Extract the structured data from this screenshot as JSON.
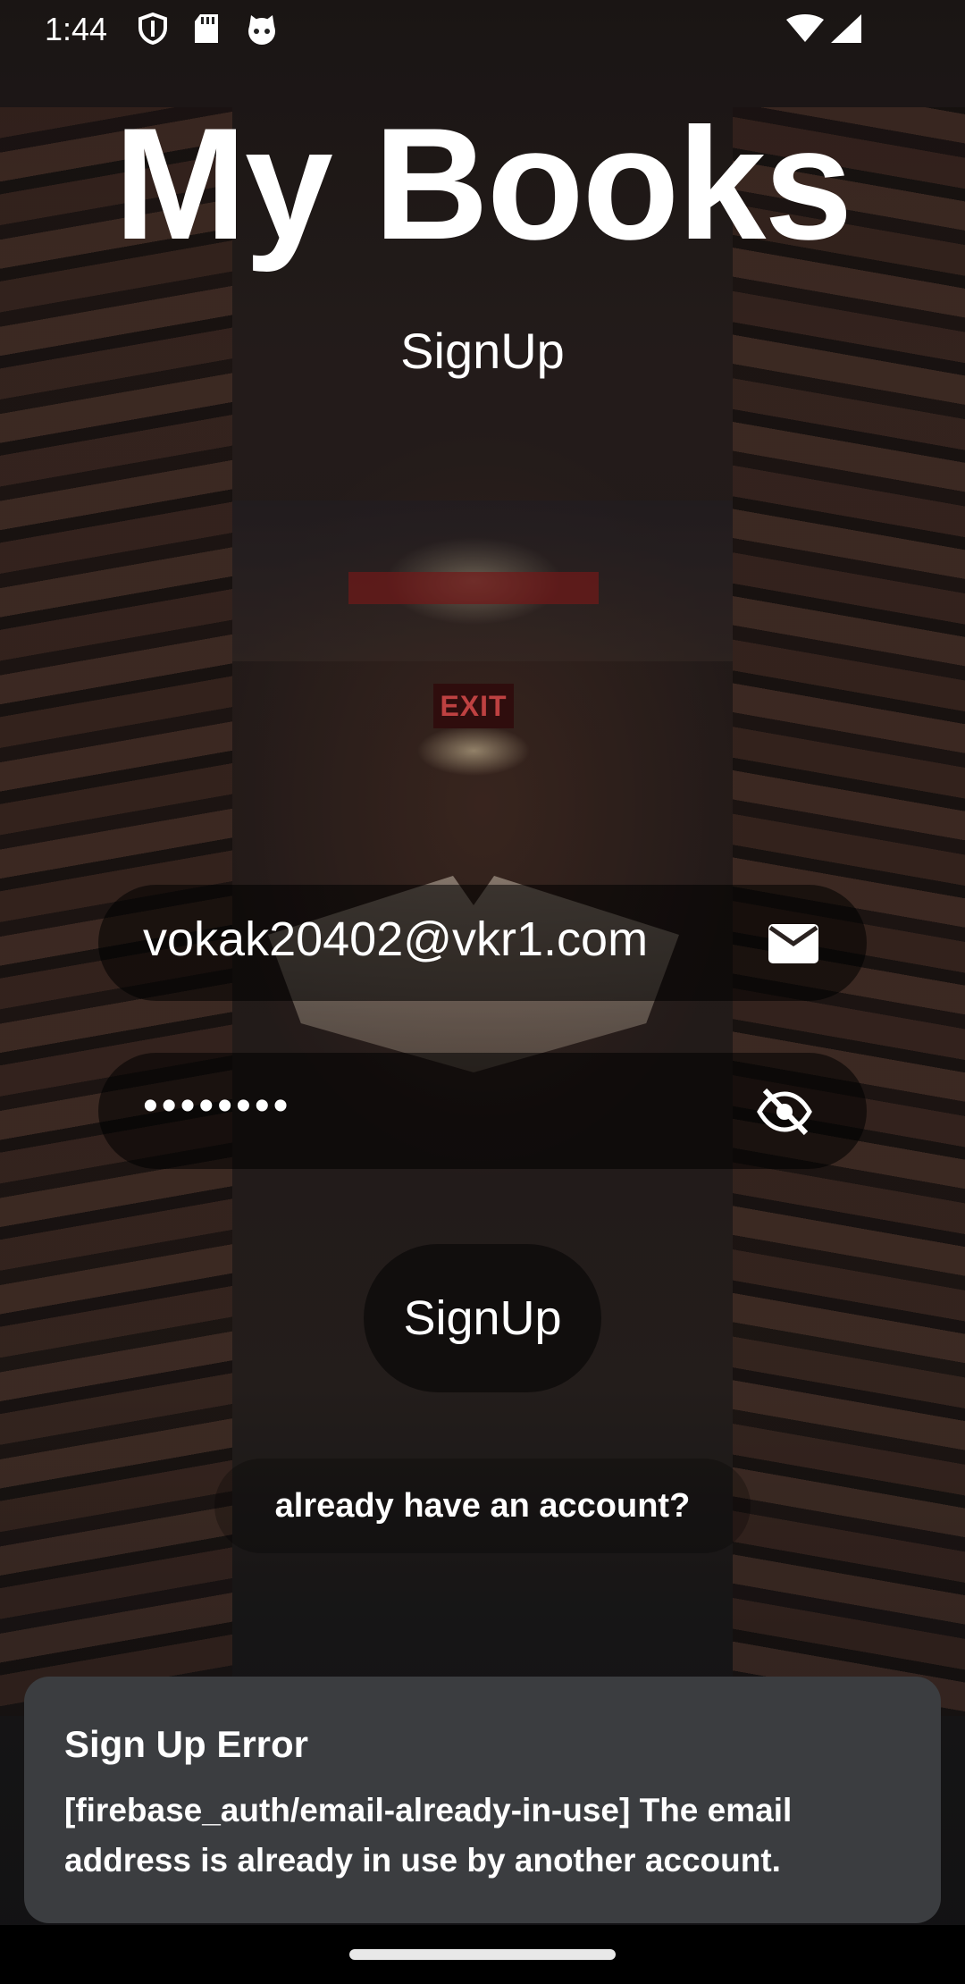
{
  "status_bar": {
    "time": "1:44"
  },
  "app": {
    "title": "My Books",
    "subtitle": "SignUp"
  },
  "form": {
    "email_value": "vokak20402@vkr1.com",
    "password_value": "••••••••",
    "email_icon": "mail-icon",
    "password_icon": "visibility-off-icon",
    "submit_label": "SignUp",
    "login_link_label": "already have an account?"
  },
  "background": {
    "exit_sign": "EXIT"
  },
  "snackbar": {
    "title": "Sign Up Error",
    "message": "[firebase_auth/email-already-in-use] The email address is already in use by another account."
  },
  "colors": {
    "snackbar_bg": "#3b3d40",
    "field_bg": "rgba(0,0,0,0.55)",
    "text": "#ffffff"
  }
}
